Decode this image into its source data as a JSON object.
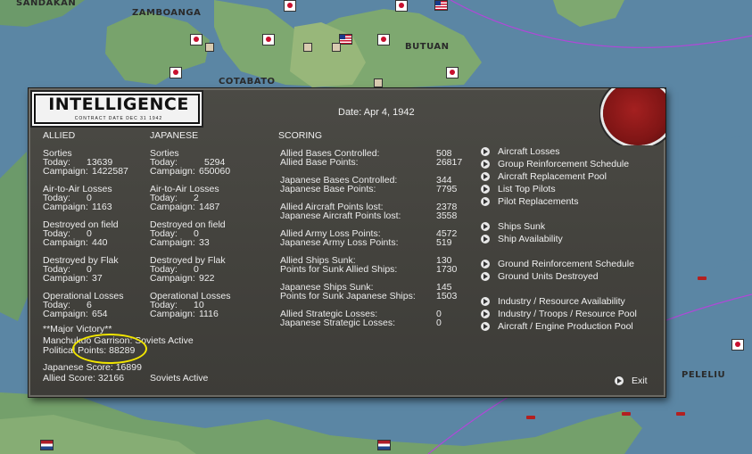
{
  "map": {
    "labels": [
      "SANDAKAN",
      "ZAMBOANGA",
      "BUTUAN",
      "COTABATO",
      "PELELIU"
    ]
  },
  "panel": {
    "title": "INTELLIGENCE",
    "subtitle": "CONTRACT DATE DEC 31 1942",
    "date": "Date: Apr 4, 1942",
    "headers": {
      "allied": "ALLIED",
      "japanese": "JAPANESE",
      "scoring": "SCORING"
    },
    "allied": {
      "sorties": {
        "title": "Sorties",
        "today_label": "Today:",
        "today": "13639",
        "campaign_label": "Campaign:",
        "campaign": "1422587"
      },
      "air_to_air": {
        "title": "Air-to-Air Losses",
        "today_label": "Today:",
        "today": "0",
        "campaign_label": "Campaign:",
        "campaign": "1163"
      },
      "destroyed_field": {
        "title": "Destroyed on field",
        "today_label": "Today:",
        "today": "0",
        "campaign_label": "Campaign:",
        "campaign": "440"
      },
      "destroyed_flak": {
        "title": "Destroyed by Flak",
        "today_label": "Today:",
        "today": "0",
        "campaign_label": "Campaign:",
        "campaign": "37"
      },
      "operational": {
        "title": "Operational Losses",
        "today_label": "Today:",
        "today": "6",
        "campaign_label": "Campaign:",
        "campaign": "654"
      }
    },
    "japanese": {
      "sorties": {
        "title": "Sorties",
        "today_label": "Today:",
        "today": "5294",
        "campaign_label": "Campaign:",
        "campaign": "650060"
      },
      "air_to_air": {
        "title": "Air-to-Air Losses",
        "today_label": "Today:",
        "today": "2",
        "campaign_label": "Campaign:",
        "campaign": "1487"
      },
      "destroyed_field": {
        "title": "Destroyed on field",
        "today_label": "Today:",
        "today": "0",
        "campaign_label": "Campaign:",
        "campaign": "33"
      },
      "destroyed_flak": {
        "title": "Destroyed by Flak",
        "today_label": "Today:",
        "today": "0",
        "campaign_label": "Campaign:",
        "campaign": "922"
      },
      "operational": {
        "title": "Operational Losses",
        "today_label": "Today:",
        "today": "10",
        "campaign_label": "Campaign:",
        "campaign": "1116"
      }
    },
    "status": {
      "victory": "**Major Victory**",
      "manchukuo": "Manchukuo Garrison: Soviets Active",
      "political_points": "Political Points:  88289",
      "japanese_score": "Japanese Score: 16899",
      "allied_score": "Allied Score: 32166",
      "soviets": "Soviets Active"
    },
    "scoring": [
      {
        "label": "Allied Bases Controlled:",
        "value": "508"
      },
      {
        "label": "Allied Base Points:",
        "value": "26817"
      },
      {
        "label": "Japanese Bases Controlled:",
        "value": "344"
      },
      {
        "label": "Japanese Base Points:",
        "value": "7795"
      },
      {
        "label": "Allied Aircraft Points lost:",
        "value": "2378"
      },
      {
        "label": "Japanese Aircraft Points lost:",
        "value": "3558"
      },
      {
        "label": "Allied Army Loss Points:",
        "value": "4572"
      },
      {
        "label": "Japanese Army Loss Points:",
        "value": "519"
      },
      {
        "label": "Allied Ships Sunk:",
        "value": "130"
      },
      {
        "label": "Points for Sunk Allied Ships:",
        "value": "1730"
      },
      {
        "label": "Japanese Ships Sunk:",
        "value": "145"
      },
      {
        "label": "Points for Sunk Japanese Ships:",
        "value": "1503"
      },
      {
        "label": "Allied Strategic Losses:",
        "value": "0"
      },
      {
        "label": "Japanese Strategic Losses:",
        "value": "0"
      }
    ],
    "menu": [
      "Aircraft Losses",
      "Group Reinforcement Schedule",
      "Aircraft Replacement Pool",
      "List Top Pilots",
      "Pilot Replacements",
      "Ships Sunk",
      "Ship Availability",
      "Ground Reinforcement Schedule",
      "Ground Units Destroyed",
      "Industry / Resource Availability",
      "Industry / Troops / Resource Pool",
      "Aircraft / Engine Production Pool"
    ],
    "exit_label": "Exit"
  }
}
